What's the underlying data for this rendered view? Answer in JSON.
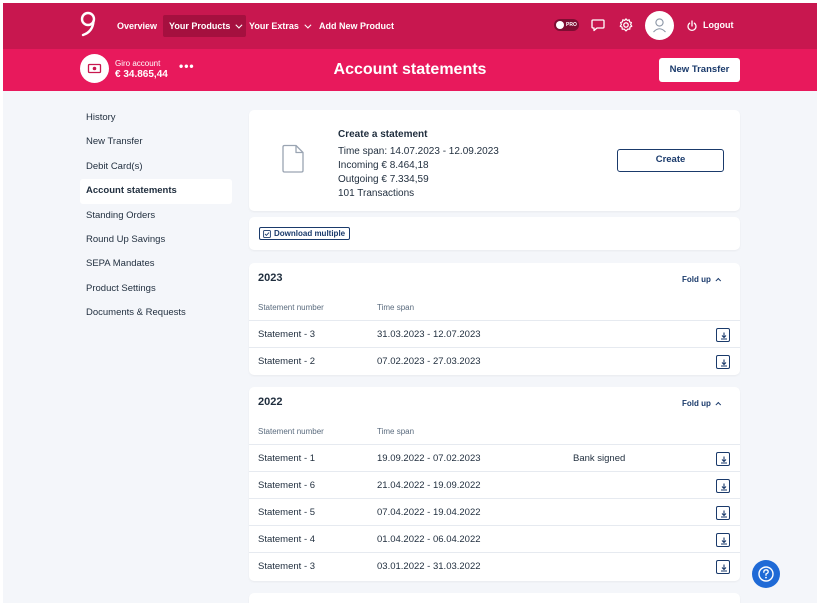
{
  "topnav": {
    "items": [
      {
        "label": "Overview"
      },
      {
        "label": "Your Products"
      },
      {
        "label": "Your Extras"
      },
      {
        "label": "Add New Product"
      }
    ],
    "pro_label": "PRO",
    "logout_label": "Logout"
  },
  "subheader": {
    "account_name": "Giro account",
    "account_balance": "€ 34.865,44",
    "more_label": "•••",
    "title": "Account statements",
    "new_transfer_label": "New Transfer"
  },
  "sidebar": {
    "items": [
      {
        "label": "History"
      },
      {
        "label": "New Transfer"
      },
      {
        "label": "Debit Card(s)"
      },
      {
        "label": "Account statements"
      },
      {
        "label": "Standing Orders"
      },
      {
        "label": "Round Up Savings"
      },
      {
        "label": "SEPA Mandates"
      },
      {
        "label": "Product Settings"
      },
      {
        "label": "Documents & Requests"
      }
    ]
  },
  "create_card": {
    "title": "Create a statement",
    "time_span": "Time span: 14.07.2023 - 12.09.2023",
    "incoming": "Incoming € 8.464,18",
    "outgoing": "Outgoing € 7.334,59",
    "transactions": "101 Transactions",
    "button_label": "Create"
  },
  "download_multiple_label": "Download multiple",
  "years": [
    {
      "year": "2023",
      "fold_label": "Fold up",
      "col_statement": "Statement number",
      "col_timespan": "Time span",
      "rows": [
        {
          "name": "Statement - 3",
          "span": "31.03.2023 - 12.07.2023",
          "note": ""
        },
        {
          "name": "Statement - 2",
          "span": "07.02.2023 - 27.03.2023",
          "note": ""
        }
      ]
    },
    {
      "year": "2022",
      "fold_label": "Fold up",
      "col_statement": "Statement number",
      "col_timespan": "Time span",
      "rows": [
        {
          "name": "Statement - 1",
          "span": "19.09.2022 - 07.02.2023",
          "note": "Bank signed"
        },
        {
          "name": "Statement - 6",
          "span": "21.04.2022 - 19.09.2022",
          "note": ""
        },
        {
          "name": "Statement - 5",
          "span": "07.04.2022 - 19.04.2022",
          "note": ""
        },
        {
          "name": "Statement - 4",
          "span": "01.04.2022 - 06.04.2022",
          "note": ""
        },
        {
          "name": "Statement - 3",
          "span": "03.01.2022 - 31.03.2022",
          "note": ""
        }
      ]
    }
  ],
  "colors": {
    "nav_bg": "#c8174f",
    "subheader_bg": "#e8195c",
    "primary_navy": "#1a3a6b",
    "help_blue": "#1f6ad6",
    "page_bg": "#f4f6fa"
  }
}
